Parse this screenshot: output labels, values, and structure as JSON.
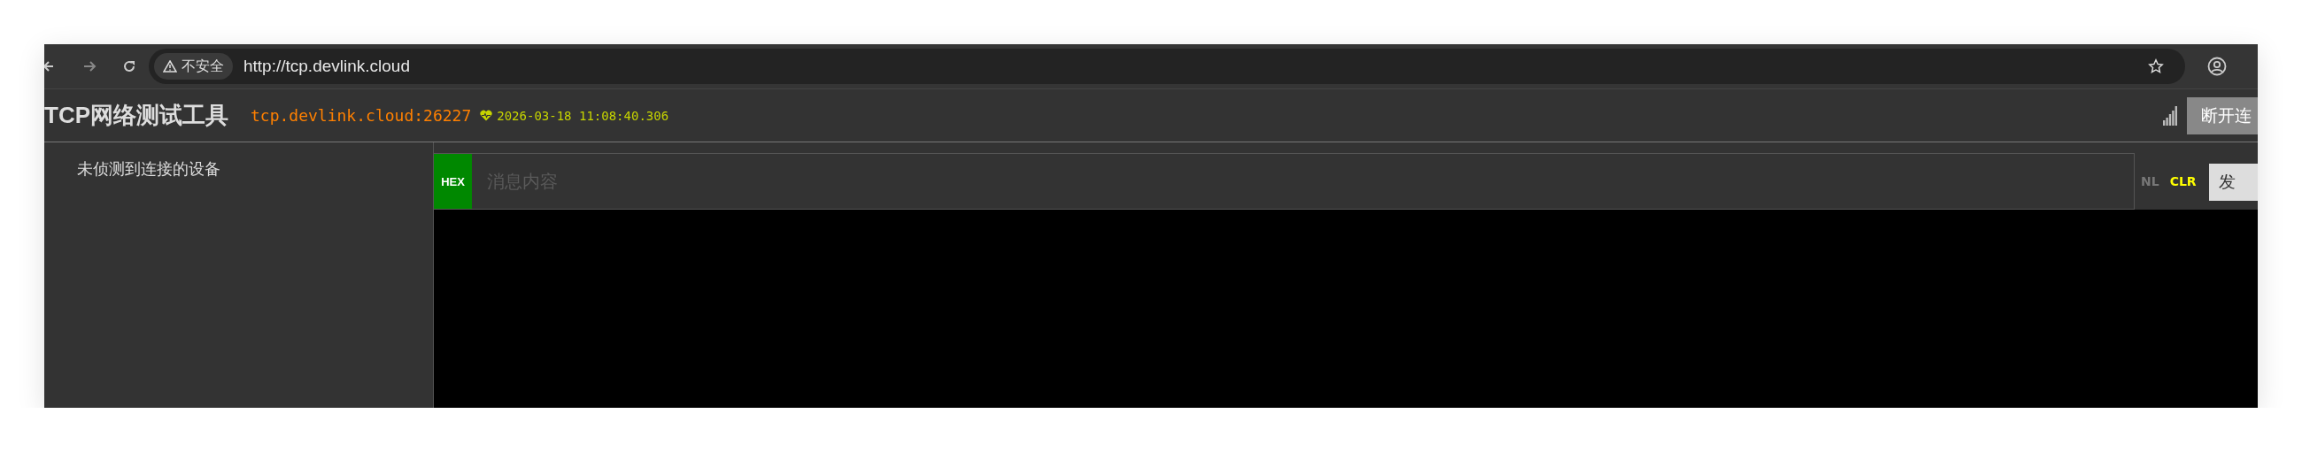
{
  "browser": {
    "security_label": "不安全",
    "url": "http://tcp.devlink.cloud"
  },
  "header": {
    "title": "TCP网络测试工具",
    "server": "tcp.devlink.cloud:26227",
    "timestamp": "2026-03-18 11:08:40.306",
    "disconnect_button": "断开连"
  },
  "sidebar": {
    "empty_message": "未侦测到连接的设备"
  },
  "composer": {
    "hex_toggle": {
      "label": "HEX",
      "on": true
    },
    "placeholder": "消息内容",
    "newline_toggle": {
      "label": "NL",
      "on": false
    },
    "clear_button": "CLR",
    "send_button": "发"
  }
}
